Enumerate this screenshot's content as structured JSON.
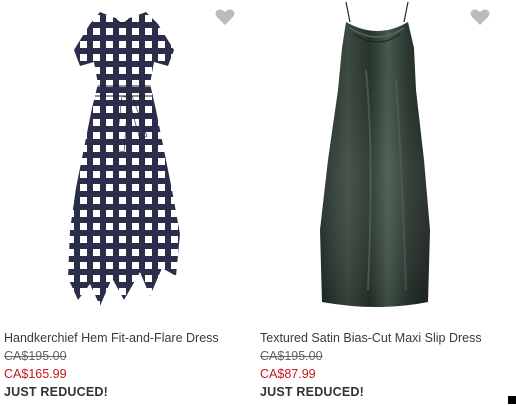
{
  "products": [
    {
      "name": "Handkerchief Hem Fit-and-Flare Dress",
      "original_price": "CA$195.00",
      "sale_price": "CA$165.99",
      "badge": "JUST REDUCED!",
      "image_icon": "dress-gingham-image",
      "favorite_icon": "heart-icon"
    },
    {
      "name": "Textured Satin Bias-Cut Maxi Slip Dress",
      "original_price": "CA$195.00",
      "sale_price": "CA$87.99",
      "badge": "JUST REDUCED!",
      "image_icon": "dress-satin-slip-image",
      "favorite_icon": "heart-icon"
    }
  ],
  "colors": {
    "sale": "#c4161c",
    "text": "#333333",
    "heart": "#bbbbbb",
    "dress_navy": "#2b2e4a",
    "dress_satin": "#2e3a33"
  }
}
